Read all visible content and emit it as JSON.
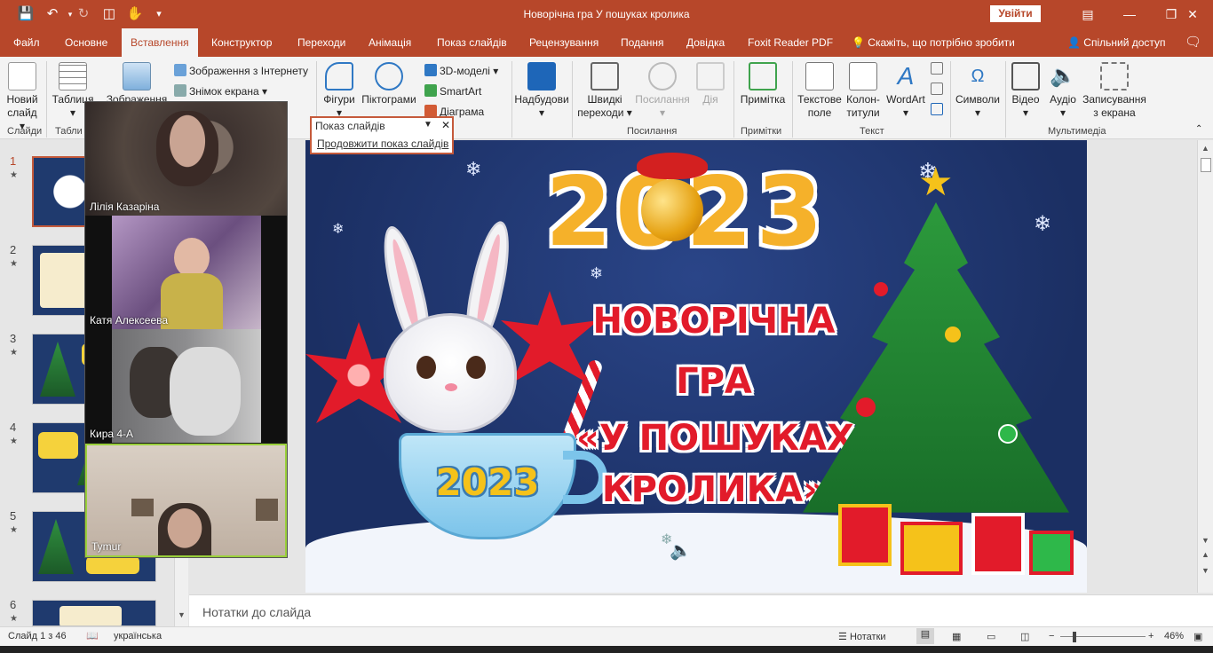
{
  "window": {
    "title": "Новорічна гра У пошуках кролика",
    "signin_label": "Увійти"
  },
  "tabs": [
    "Файл",
    "Основне",
    "Вставлення",
    "Конструктор",
    "Переходи",
    "Анімація",
    "Показ слайдів",
    "Рецензування",
    "Подання",
    "Довідка",
    "Foxit Reader PDF"
  ],
  "tell_me": "Скажіть, що потрібно зробити",
  "share": "Спільний доступ",
  "ribbon": {
    "new_slide": [
      "Новий",
      "слайд ▾"
    ],
    "table": [
      "Таблиця",
      "▾"
    ],
    "images": "Зображення",
    "online_pictures": "Зображення з Інтернету",
    "screenshot": "Знімок екрана ▾",
    "shapes": [
      "Фігури",
      "▾"
    ],
    "icons": "Піктограми",
    "models3d": "3D-моделі",
    "smartart": "SmartArt",
    "chart": "Діаграма",
    "addins": [
      "Надбудови",
      "▾"
    ],
    "quick_transitions": [
      "Швидкі",
      "переходи ▾"
    ],
    "links": [
      "Посилання",
      "▾"
    ],
    "action": "Дія",
    "comment": "Примітка",
    "textbox": [
      "Текстове",
      "поле"
    ],
    "header_footer": [
      "Колон-",
      "титули"
    ],
    "wordart": [
      "WordArt",
      "▾"
    ],
    "symbols": [
      "Символи",
      "▾"
    ],
    "video": [
      "Відео",
      "▾"
    ],
    "audio": [
      "Аудіо",
      "▾"
    ],
    "screen_recording": [
      "Записування",
      "з екрана"
    ],
    "groups": {
      "slides": "Слайди",
      "tables": "Табли",
      "links": "Посилання",
      "comments": "Примітки",
      "text": "Текст",
      "media": "Мультимедіа"
    }
  },
  "popup": {
    "title": "Показ слайдів",
    "continue": "Продовжити показ слайдів"
  },
  "participants": [
    "Лілія Казаріна",
    "Катя Алексеева",
    "Кира 4-А",
    "Tymur"
  ],
  "thumbnails": [
    "1",
    "2",
    "3",
    "4",
    "5",
    "6"
  ],
  "slide": {
    "year": "2023",
    "cup_year": "2023",
    "title_lines": [
      "НОВОРІЧНА",
      "ГРА",
      "«У ПОШУКАХ",
      "КРОЛИКА»"
    ]
  },
  "notes_placeholder": "Нотатки до слайда",
  "status": {
    "slide_counter": "Слайд 1 з 46",
    "language": "українська",
    "notes_button": "Нотатки",
    "zoom": "46%"
  },
  "colors": {
    "accent": "#b7472a",
    "title_red": "#e21b2a",
    "slide_bg": "#1b2f63"
  }
}
